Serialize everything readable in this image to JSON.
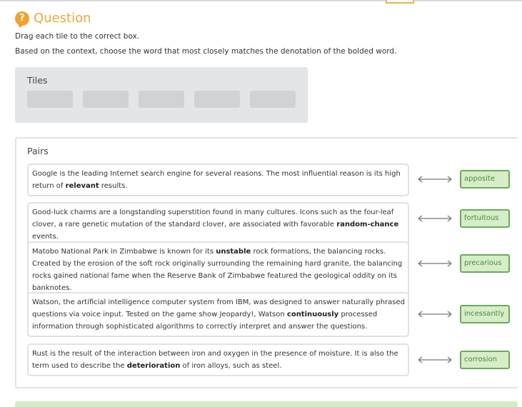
{
  "header": {
    "icon": "question-mark-icon",
    "icon_glyph": "?",
    "title": "Question"
  },
  "instructions": [
    "Drag each tile to the correct box.",
    "Based on the context, choose the word that most closely matches the denotation of the bolded word."
  ],
  "tiles": {
    "label": "Tiles",
    "slots": 5
  },
  "pairs": {
    "label": "Pairs",
    "items": [
      {
        "before": "Google is the leading Internet search engine for several reasons. The most influential reason is its high return of ",
        "bold": "relevant",
        "after": " results.",
        "answer": "apposite"
      },
      {
        "before": "Good-luck charms are a longstanding superstition found in many cultures. Icons such as the four-leaf clover, a rare genetic mutation of the standard clover, are associated with favorable ",
        "bold": "random-chance",
        "after": " events.",
        "answer": "fortuitous"
      },
      {
        "before": "Matobo National Park in Zimbabwe is known for its ",
        "bold": "unstable",
        "after": " rock formations, the balancing rocks. Created by the erosion of the soft rock originally surrounding the remaining hard granite, the balancing rocks gained national fame when the Reserve Bank of Zimbabwe featured the geological oddity on its banknotes.",
        "answer": "precarious"
      },
      {
        "before": "Watson, the artificial intelligence computer system from IBM, was designed to answer naturally phrased questions via voice input. Tested on the game show Jeopardy!, Watson ",
        "bold": "continuously",
        "after": " processed information through sophisticated algorithms to correctly interpret and answer the questions.",
        "answer": "incessantly"
      },
      {
        "before": "Rust is the result of the interaction between iron and oxygen in the presence of moisture. It is also the term used to describe the ",
        "bold": "deterioration",
        "after": " of iron alloys, such as steel.",
        "answer": "corrosion"
      }
    ]
  },
  "colors": {
    "accent": "#e8a73f",
    "answer_border": "#6bab5a",
    "answer_fill": "#d6edc7"
  }
}
